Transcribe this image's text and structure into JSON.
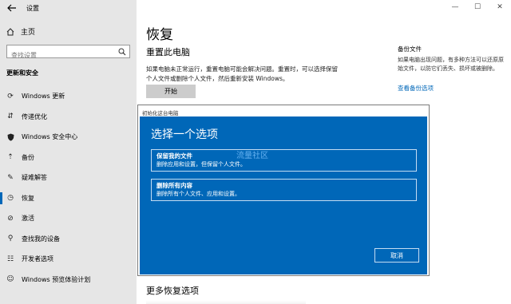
{
  "window": {
    "title": "设置",
    "controls": [
      "—",
      "☐",
      "✕"
    ]
  },
  "sidebar": {
    "home": "主页",
    "search_placeholder": "查找设置",
    "section": "更新和安全",
    "items": [
      {
        "label": "Windows 更新",
        "icon": "sync-icon"
      },
      {
        "label": "传递优化",
        "icon": "delivery-icon"
      },
      {
        "label": "Windows 安全中心",
        "icon": "shield-icon"
      },
      {
        "label": "备份",
        "icon": "backup-icon"
      },
      {
        "label": "疑难解答",
        "icon": "wrench-icon"
      },
      {
        "label": "恢复",
        "icon": "history-icon",
        "active": true
      },
      {
        "label": "激活",
        "icon": "check-circle-icon"
      },
      {
        "label": "查找我的设备",
        "icon": "person-location-icon"
      },
      {
        "label": "开发者选项",
        "icon": "dev-icon"
      },
      {
        "label": "Windows 预览体验计划",
        "icon": "insider-icon"
      }
    ]
  },
  "main": {
    "title": "恢复",
    "reset_heading": "重置此电脑",
    "reset_desc": "如果电脑未正常运行，重置电脑可能会解决问题。重置时，可以选择保留个人文件或删除个人文件，然后重新安装 Windows。",
    "start_button": "开始",
    "more_recovery": "更多恢复选项"
  },
  "related": {
    "heading": "备份文件",
    "desc": "如果电脑出现问题，有多种方法可以还原原始文件，以防它们丢失、损坏或被删除。",
    "link": "查看备份选项"
  },
  "dialog": {
    "title": "初始化这台电脑",
    "heading": "选择一个选项",
    "watermark": "流量社区",
    "options": [
      {
        "title": "保留我的文件",
        "desc": "删除应用和设置，但保留个人文件。"
      },
      {
        "title": "删除所有内容",
        "desc": "删除所有个人文件、应用和设置。"
      }
    ],
    "cancel": "取消"
  },
  "colors": {
    "accent": "#0067b8",
    "sidebar_bg": "#e6e6e6"
  }
}
